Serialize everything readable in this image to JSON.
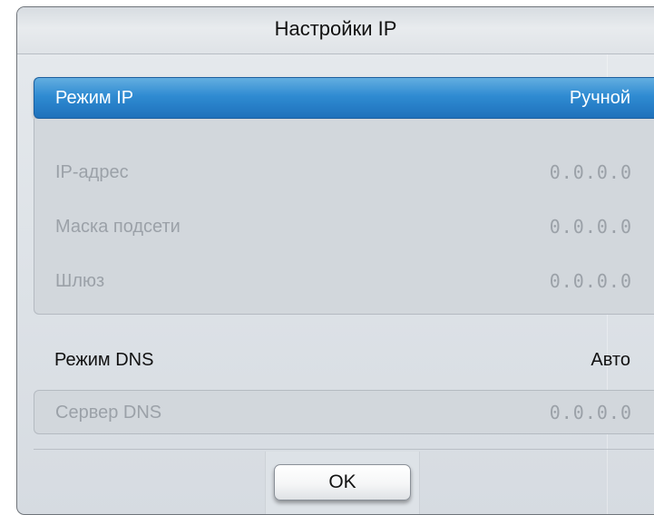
{
  "dialog": {
    "title": "Настройки IP"
  },
  "ip_mode": {
    "label": "Режим IP",
    "value": "Ручной"
  },
  "ip_fields": [
    {
      "label": "IP-адрес",
      "value": "0.0.0.0"
    },
    {
      "label": "Маска подсети",
      "value": "0.0.0.0"
    },
    {
      "label": "Шлюз",
      "value": "0.0.0.0"
    }
  ],
  "dns_mode": {
    "label": "Режим DNS",
    "value": "Авто"
  },
  "dns_server": {
    "label": "Сервер DNS",
    "value": "0.0.0.0"
  },
  "buttons": {
    "ok_label": "OK"
  },
  "colors": {
    "selection": "#2f8bd2",
    "disabled_text": "#9ba1a8"
  }
}
